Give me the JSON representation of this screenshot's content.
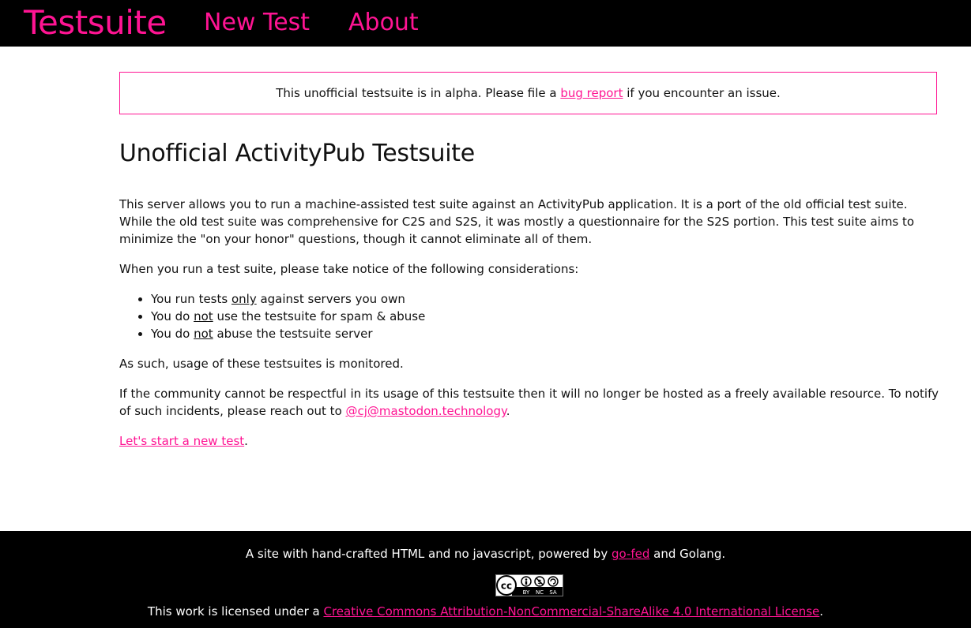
{
  "nav": {
    "brand": "Testsuite",
    "new_test": "New Test",
    "about": "About"
  },
  "alert": {
    "before": "This unofficial testsuite is in alpha. Please file a ",
    "link": "bug report",
    "after": " if you encounter an issue."
  },
  "main": {
    "title": "Unofficial ActivityPub Testsuite",
    "intro": "This server allows you to run a machine-assisted test suite against an ActivityPub application. It is a port of the old official test suite. While the old test suite was comprehensive for C2S and S2S, it was mostly a questionnaire for the S2S portion. This test suite aims to minimize the \"on your honor\" questions, though it cannot eliminate all of them.",
    "considerations_lead": "When you run a test suite, please take notice of the following considerations:",
    "items": [
      {
        "before": "You run tests ",
        "emph": "only",
        "after": " against servers you own"
      },
      {
        "before": "You do ",
        "emph": "not",
        "after": " use the testsuite for spam & abuse"
      },
      {
        "before": "You do ",
        "emph": "not",
        "after": " abuse the testsuite server"
      }
    ],
    "monitored": "As such, usage of these testsuites is monitored.",
    "community_before": "If the community cannot be respectful in its usage of this testsuite then it will no longer be hosted as a freely available resource. To notify of such incidents, please reach out to ",
    "community_link": "@cj@mastodon.technology",
    "community_after": ".",
    "start_link": "Let's start a new test",
    "start_after": "."
  },
  "footer": {
    "line1_before": "A site with hand-crafted HTML and no javascript, powered by ",
    "line1_link": "go-fed",
    "line1_after": " and Golang.",
    "badge_cc": "cc",
    "badge_by": "BY",
    "badge_nc": "NC",
    "badge_sa": "SA",
    "line3_before": "This work is licensed under a ",
    "line3_link": "Creative Commons Attribution-NonCommercial-ShareAlike 4.0 International License",
    "line3_after": "."
  },
  "colors": {
    "accent": "#ff1493",
    "bar": "#000000"
  }
}
